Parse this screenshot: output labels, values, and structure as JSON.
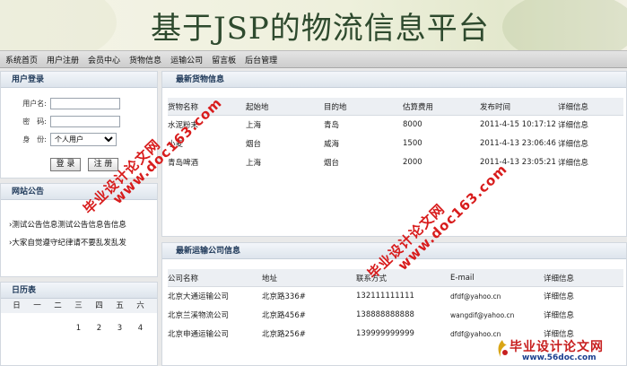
{
  "site": {
    "title": "基于JSP的物流信息平台"
  },
  "nav": [
    "系统首页",
    "用户注册",
    "会员中心",
    "货物信息",
    "运输公司",
    "留言板",
    "后台管理"
  ],
  "login": {
    "title": "用户登录",
    "username_label": "用户名:",
    "password_label": "密　码:",
    "role_label": "身　份:",
    "role_value": "个人用户",
    "login_button": "登 录",
    "register_button": "注 册"
  },
  "notice": {
    "title": "网站公告",
    "items": [
      "测试公告信息测试公告信息告信息",
      "大家自觉遵守纪律请不要乱发乱发"
    ]
  },
  "calendar": {
    "title": "日历表",
    "weekdays": [
      "日",
      "一",
      "二",
      "三",
      "四",
      "五",
      "六"
    ],
    "first_row": [
      "",
      "",
      "",
      "1",
      "2",
      "3",
      "4"
    ]
  },
  "goods": {
    "title": "最新货物信息",
    "columns": [
      "货物名称",
      "起始地",
      "目的地",
      "估算费用",
      "发布时间",
      "详细信息"
    ],
    "rows": [
      [
        "水泥粉末",
        "上海",
        "青岛",
        "8000",
        "2011-4-15 10:17:12",
        "详细信息"
      ],
      [
        "小麦",
        "烟台",
        "威海",
        "1500",
        "2011-4-13 23:06:46",
        "详细信息"
      ],
      [
        "青岛啤酒",
        "上海",
        "烟台",
        "2000",
        "2011-4-13 23:05:21",
        "详细信息"
      ]
    ]
  },
  "companies": {
    "title": "最新运输公司信息",
    "columns": [
      "公司名称",
      "地址",
      "联系方式",
      "E-mail",
      "详细信息"
    ],
    "rows": [
      [
        "北京大通运输公司",
        "北京路336#",
        "132111111111",
        "dfdf@yahoo.cn",
        "详细信息"
      ],
      [
        "北京兰溪物流公司",
        "北京路456#",
        "138888888888",
        "wangdif@yahoo.cn",
        "详细信息"
      ],
      [
        "北京申通运输公司",
        "北京路256#",
        "139999999999",
        "dfdf@yahoo.cn",
        "详细信息"
      ]
    ]
  },
  "watermark": {
    "text_cn": "毕业设计论文网",
    "text_url": "www.doc163.com",
    "footer_cn": "毕业设计论文网",
    "footer_url": "www.56doc.com"
  },
  "colors": {
    "panel_head": "#203a5a",
    "watermark_red": "#d81c1c",
    "watermark_blue": "#1a3f8f"
  }
}
